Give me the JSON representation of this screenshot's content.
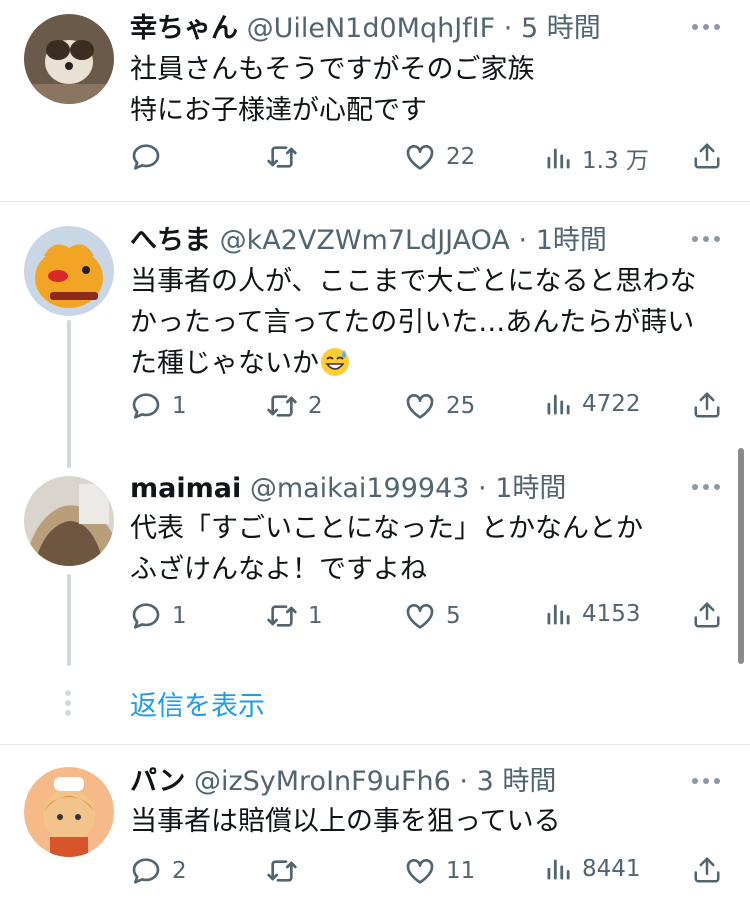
{
  "tweets": [
    {
      "name": "幸ちゃん",
      "handle": "@UileN1d0MqhJfIF",
      "separator": "·",
      "time": "5 時間",
      "text": "社員さんもそうですがそのご家族\n特にお子様達が心配です",
      "replies": "",
      "retweets": "",
      "likes": "22",
      "views": "1.3 万"
    },
    {
      "name": "へちま",
      "handle": "@kA2VZWm7LdJJAOA",
      "separator": "·",
      "time": "1時間",
      "text": "当事者の人が、ここまで大ごとになると思わな\nかったって言ってたの引いた…あんたらが蒔い\nた種じゃないか",
      "emoji": "sweat-smile-emoji",
      "replies": "1",
      "retweets": "2",
      "likes": "25",
      "views": "4722"
    },
    {
      "name": "maimai",
      "handle": "@maikai199943",
      "separator": "·",
      "time": "1時間",
      "text": "代表「すごいことになった」とかなんとか\nふざけんなよ！ですよね",
      "replies": "1",
      "retweets": "1",
      "likes": "5",
      "views": "4153"
    },
    {
      "name": "パン",
      "handle": "@izSyMroInF9uFh6",
      "separator": "·",
      "time": "3 時間",
      "text": "当事者は賠償以上の事を狙っている",
      "replies": "2",
      "retweets": "",
      "likes": "11",
      "views": "8441"
    }
  ],
  "show_replies_label": "返信を表示",
  "icons": [
    "reply-icon",
    "retweet-icon",
    "like-icon",
    "views-icon",
    "share-icon",
    "more-icon"
  ],
  "colors": {
    "text": "#0f1419",
    "muted": "#536471",
    "link": "#1d9bf0",
    "divider": "#e6e9eb"
  }
}
